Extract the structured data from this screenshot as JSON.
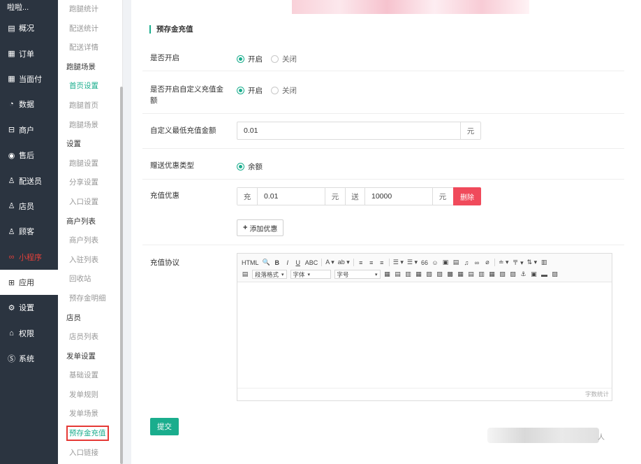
{
  "sidebar": {
    "brand": "啦啦...",
    "items": [
      {
        "label": "概况",
        "icon": "calendar-icon",
        "glyph": "▤"
      },
      {
        "label": "订单",
        "icon": "list-icon",
        "glyph": "▦"
      },
      {
        "label": "当面付",
        "icon": "list-icon",
        "glyph": "▦"
      },
      {
        "label": "数据",
        "icon": "chart-circle-icon",
        "glyph": "◔"
      },
      {
        "label": "商户",
        "icon": "store-icon",
        "glyph": "⊟"
      },
      {
        "label": "售后",
        "icon": "after-sales-icon",
        "glyph": "◉"
      },
      {
        "label": "配送员",
        "icon": "user-icon",
        "glyph": "♙"
      },
      {
        "label": "店员",
        "icon": "user-icon",
        "glyph": "♙"
      },
      {
        "label": "顾客",
        "icon": "user-icon",
        "glyph": "♙"
      },
      {
        "label": "小程序",
        "icon": "miniprogram-icon",
        "glyph": "∞"
      },
      {
        "label": "应用",
        "icon": "apps-icon",
        "glyph": "⊞"
      },
      {
        "label": "设置",
        "icon": "gear-icon",
        "glyph": "⚙"
      },
      {
        "label": "权限",
        "icon": "lock-icon",
        "glyph": "⌂"
      },
      {
        "label": "系统",
        "icon": "system-icon",
        "glyph": "Ⓢ"
      }
    ]
  },
  "submenu": {
    "rows": [
      {
        "label": "跑腿统计",
        "kind": "sub"
      },
      {
        "label": "配送统计",
        "kind": "sub"
      },
      {
        "label": "配送详情",
        "kind": "sub"
      },
      {
        "label": "跑腿场景",
        "kind": "head"
      },
      {
        "label": "首页设置",
        "kind": "sub-active"
      },
      {
        "label": "跑腿首页",
        "kind": "sub"
      },
      {
        "label": "跑腿场景",
        "kind": "sub"
      },
      {
        "label": "设置",
        "kind": "head"
      },
      {
        "label": "跑腿设置",
        "kind": "sub"
      },
      {
        "label": "分享设置",
        "kind": "sub"
      },
      {
        "label": "入口设置",
        "kind": "sub"
      },
      {
        "label": "商户列表",
        "kind": "head"
      },
      {
        "label": "商户列表",
        "kind": "sub"
      },
      {
        "label": "入驻列表",
        "kind": "sub"
      },
      {
        "label": "回收站",
        "kind": "sub"
      },
      {
        "label": "预存金明细",
        "kind": "sub"
      },
      {
        "label": "店员",
        "kind": "head"
      },
      {
        "label": "店员列表",
        "kind": "sub"
      },
      {
        "label": "发单设置",
        "kind": "head"
      },
      {
        "label": "基础设置",
        "kind": "sub"
      },
      {
        "label": "发单规则",
        "kind": "sub"
      },
      {
        "label": "发单场景",
        "kind": "sub"
      },
      {
        "label": "预存金充值",
        "kind": "boxed"
      },
      {
        "label": "入口链接",
        "kind": "sub"
      }
    ]
  },
  "form": {
    "section_title": "预存金充值",
    "enable": {
      "label": "是否开启",
      "on": "开启",
      "off": "关闭"
    },
    "custom_enable": {
      "label": "是否开启自定义充值金额",
      "on": "开启",
      "off": "关闭"
    },
    "min_amount": {
      "label": "自定义最低充值金额",
      "value": "0.01",
      "unit": "元"
    },
    "gift_type": {
      "label": "赠送优惠类型",
      "option": "余额"
    },
    "promo": {
      "label": "充值优惠",
      "prefix": "充",
      "amount": "0.01",
      "unit1": "元",
      "mid": "送",
      "gift": "10000",
      "unit2": "元",
      "delete_label": "删除"
    },
    "add_promo_label": "添加优惠",
    "agreement": {
      "label": "充值协议",
      "toolbar_row1": [
        "HTML",
        "🔍",
        "B",
        "I",
        "U",
        "ABC",
        "A ▾",
        "ab ▾",
        "≡",
        "≡",
        "≡",
        "☰ ▾",
        "☰ ▾",
        "66",
        "☺",
        "▣",
        "▤",
        "♫",
        "∞",
        "⌀",
        "≐ ▾",
        "〒 ▾",
        "⇅ ▾",
        "▥"
      ],
      "toolbar_row2": [
        "▦",
        "▤",
        "▥",
        "▦",
        "▧",
        "▨",
        "▩",
        "▦",
        "▤",
        "▥",
        "▦",
        "▧",
        "▨",
        "⚓",
        "▣",
        "▬",
        "▨"
      ],
      "paragraph_select": "段落格式",
      "font_select": "字体",
      "size_select": "字号",
      "word_count": "字数统计"
    },
    "submit_label": "提交",
    "footer_text": "人"
  }
}
